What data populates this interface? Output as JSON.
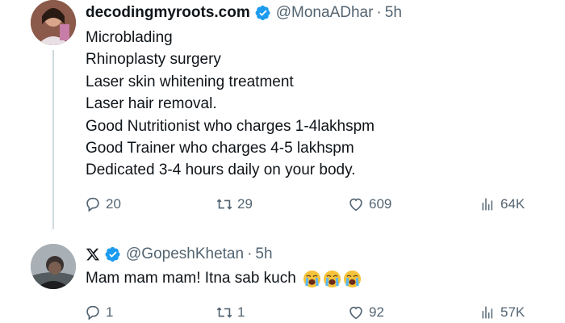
{
  "tweet": {
    "display_name": "decodingmyroots.com",
    "handle": "@MonaADhar",
    "separator": "·",
    "time": "5h",
    "lines": [
      "Microblading",
      "Rhinoplasty surgery",
      "Laser skin whitening treatment",
      "Laser hair removal.",
      "Good Nutritionist who charges 1-4lakhspm",
      "Good Trainer who charges 4-5 lakhspm",
      "Dedicated 3-4 hours daily on your body."
    ],
    "actions": {
      "replies": "20",
      "reposts": "29",
      "likes": "609",
      "views": "64K"
    }
  },
  "reply": {
    "handle": "@GopeshKhetan",
    "separator": "·",
    "time": "5h",
    "text": "Mam mam mam! Itna sab kuch",
    "emoji": "loudly-crying-face",
    "emoji_count": 3,
    "actions": {
      "replies": "1",
      "reposts": "1",
      "likes": "92",
      "views": "57K"
    }
  },
  "colors": {
    "verified": "#1d9bf0",
    "muted": "#536471",
    "thread_line": "#cfd9de"
  }
}
